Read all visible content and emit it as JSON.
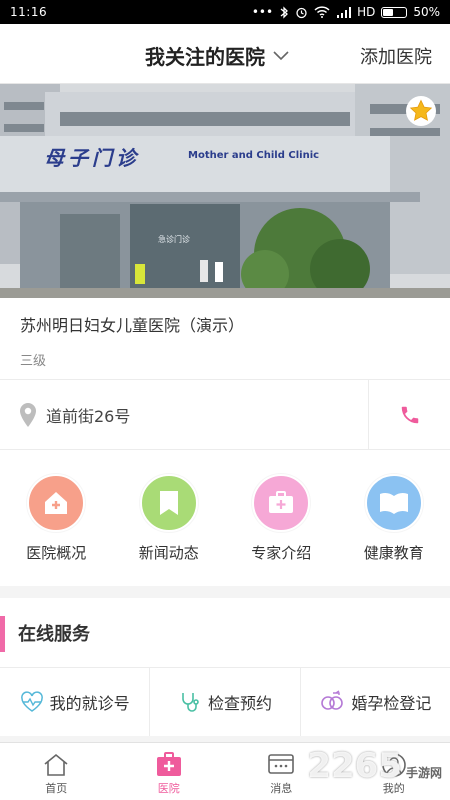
{
  "status_bar": {
    "time": "11:16",
    "signal": "HD",
    "battery": "50%",
    "battery_level": 0.5
  },
  "header": {
    "title": "我关注的医院",
    "action": "添加医院"
  },
  "banner": {
    "sign_cn": "母子门诊",
    "sign_en": "Mother and Child Clinic",
    "sign_small": "急诊门诊"
  },
  "hospital": {
    "name": "苏州明日妇女儿童医院（演示）",
    "level": "三级"
  },
  "address": {
    "text": "道前街26号"
  },
  "quick_menu": [
    {
      "label": "医院概况",
      "icon": "house-plus-icon",
      "color": "#f7a08a"
    },
    {
      "label": "新闻动态",
      "icon": "bookmark-icon",
      "color": "#a9db76"
    },
    {
      "label": "专家介绍",
      "icon": "medical-case-icon",
      "color": "#f6a8d6"
    },
    {
      "label": "健康教育",
      "icon": "open-book-icon",
      "color": "#8bc2f2"
    }
  ],
  "service": {
    "title": "在线服务",
    "items": [
      {
        "label": "我的就诊号",
        "icon": "heart-pulse-icon"
      },
      {
        "label": "检查预约",
        "icon": "stethoscope-icon"
      },
      {
        "label": "婚孕检登记",
        "icon": "gender-rings-icon"
      }
    ]
  },
  "tabs": [
    {
      "label": "首页",
      "icon": "home-icon"
    },
    {
      "label": "医院",
      "icon": "hospital-icon"
    },
    {
      "label": "消息",
      "icon": "message-icon"
    },
    {
      "label": "我的",
      "icon": "user-icon"
    }
  ],
  "colors": {
    "accent": "#ef5b9c",
    "status_bg": "#000000"
  },
  "watermark": {
    "main": "2265",
    "sub": "手游网"
  }
}
